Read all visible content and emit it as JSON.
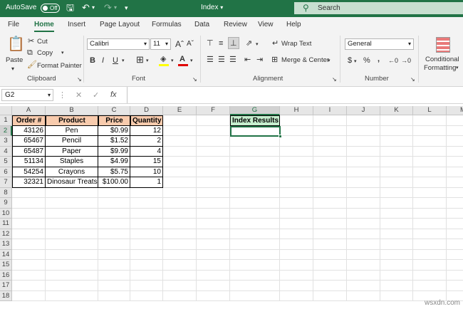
{
  "titlebar": {
    "autosave": "AutoSave",
    "toggle": "Off",
    "doc_title": "Index",
    "search": "Search"
  },
  "tabs": [
    "File",
    "Home",
    "Insert",
    "Page Layout",
    "Formulas",
    "Data",
    "Review",
    "View",
    "Help"
  ],
  "active_tab": "Home",
  "ribbon": {
    "clipboard": {
      "paste": "Paste",
      "cut": "Cut",
      "copy": "Copy",
      "format_painter": "Format Painter",
      "group": "Clipboard"
    },
    "font": {
      "name": "Calibri",
      "size": "11",
      "group": "Font"
    },
    "alignment": {
      "wrap_text": "Wrap Text",
      "merge_center": "Merge & Center",
      "group": "Alignment"
    },
    "number": {
      "format": "General",
      "group": "Number",
      "currency": "$",
      "percent": "%",
      "comma": ","
    },
    "styles": {
      "conditional_1": "Conditional",
      "conditional_2": "Formatting"
    }
  },
  "formula_bar": {
    "name_box": "G2",
    "fx": "fx",
    "value": ""
  },
  "columns": [
    "A",
    "B",
    "C",
    "D",
    "E",
    "F",
    "G",
    "H",
    "I",
    "J",
    "K",
    "L",
    "M"
  ],
  "selected_column": "G",
  "rows": [
    "1",
    "2",
    "3",
    "4",
    "5",
    "6",
    "7",
    "8",
    "9",
    "10",
    "11",
    "12",
    "13",
    "14",
    "15",
    "16",
    "17",
    "18"
  ],
  "selected_row": "2",
  "table": {
    "headers": [
      "Order #",
      "Product",
      "Price",
      "Quantity"
    ],
    "rows": [
      [
        "43126",
        "Pen",
        "$0.99",
        "12"
      ],
      [
        "65467",
        "Pencil",
        "$1.52",
        "2"
      ],
      [
        "65487",
        "Paper",
        "$9.99",
        "4"
      ],
      [
        "51134",
        "Staples",
        "$4.99",
        "15"
      ],
      [
        "54254",
        "Crayons",
        "$5.75",
        "10"
      ],
      [
        "32321",
        "Dinosaur Treats",
        "$100.00",
        "1"
      ]
    ]
  },
  "results_label": "Index Results",
  "active_cell": "G2",
  "watermark": "wsxdn.com",
  "colors": {
    "accent": "#217346",
    "header_fill": "#f8cbad",
    "result_fill": "#c6efce"
  }
}
